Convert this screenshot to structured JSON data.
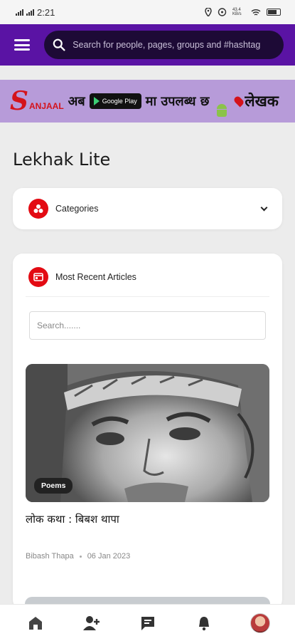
{
  "status_bar": {
    "time": "2:21",
    "net_speed": "43.4 KB/s"
  },
  "app_bar": {
    "search_placeholder": "Search for people, pages, groups and #hashtag"
  },
  "banner": {
    "logo_initial": "S",
    "logo_rest": "ANJAAL",
    "text_before": "अब",
    "badge_text": "Google Play",
    "text_after": "मा उपलब्ध छ",
    "lekhak_text": "लेखक"
  },
  "page": {
    "title": "Lekhak Lite"
  },
  "categories": {
    "label": "Categories"
  },
  "articles": {
    "heading": "Most Recent Articles",
    "search_placeholder": "Search.......",
    "items": [
      {
        "category": "Poems",
        "title": "लोक कथा : बिबश थापा",
        "author": "Bibash Thapa",
        "date": "06 Jan 2023"
      }
    ]
  },
  "colors": {
    "brand_purple": "#5a13a4",
    "search_dark": "#1d0a36",
    "accent_red": "#e30b13",
    "banner_bg": "#b79bd9"
  },
  "bottom_nav": {
    "items": [
      "home-icon",
      "add-friend-icon",
      "chat-icon",
      "bell-icon",
      "profile-avatar"
    ]
  }
}
